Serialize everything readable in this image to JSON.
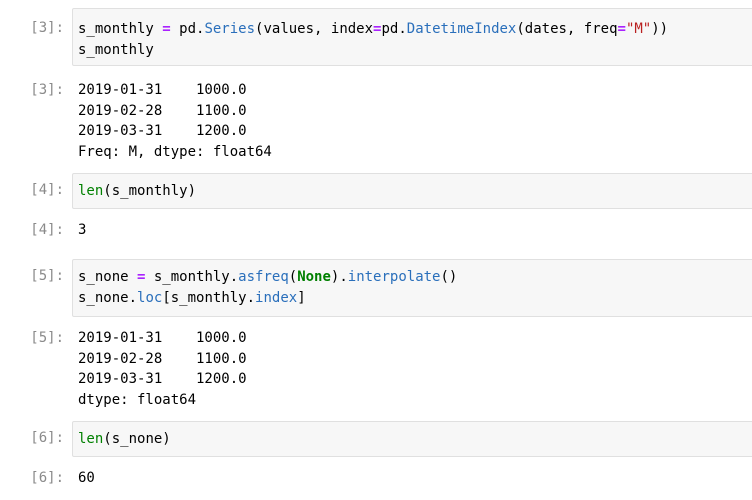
{
  "cells": [
    {
      "in_prompt": "[3]:",
      "code": [
        [
          [
            "s_monthly ",
            "t"
          ],
          [
            "=",
            "op"
          ],
          [
            " pd.",
            "t"
          ],
          [
            "Series",
            "fn"
          ],
          [
            "(values, index",
            "t"
          ],
          [
            "=",
            "op"
          ],
          [
            "pd.",
            "t"
          ],
          [
            "DatetimeIndex",
            "fn"
          ],
          [
            "(dates, freq",
            "t"
          ],
          [
            "=",
            "op"
          ],
          [
            "\"M\"",
            "str"
          ],
          [
            "))",
            "t"
          ]
        ],
        [
          [
            "s_monthly",
            "t"
          ]
        ]
      ],
      "out_prompt": "[3]:",
      "output": [
        "2019-01-31    1000.0",
        "2019-02-28    1100.0",
        "2019-03-31    1200.0",
        "Freq: M, dtype: float64"
      ]
    },
    {
      "in_prompt": "[4]:",
      "code": [
        [
          [
            "len",
            "builtin"
          ],
          [
            "(s_monthly)",
            "t"
          ]
        ]
      ],
      "out_prompt": "[4]:",
      "output": [
        "3"
      ]
    },
    {
      "in_prompt": "[5]:",
      "code": [
        [
          [
            "s_none ",
            "t"
          ],
          [
            "=",
            "op"
          ],
          [
            " s_monthly.",
            "t"
          ],
          [
            "asfreq",
            "fn"
          ],
          [
            "(",
            "t"
          ],
          [
            "None",
            "kw"
          ],
          [
            ").",
            "t"
          ],
          [
            "interpolate",
            "fn"
          ],
          [
            "()",
            "t"
          ]
        ],
        [
          [
            "s_none.",
            "t"
          ],
          [
            "loc",
            "fn"
          ],
          [
            "[s_monthly.",
            "t"
          ],
          [
            "index",
            "fn"
          ],
          [
            "]",
            "t"
          ]
        ]
      ],
      "out_prompt": "[5]:",
      "output": [
        "2019-01-31    1000.0",
        "2019-02-28    1100.0",
        "2019-03-31    1200.0",
        "dtype: float64"
      ]
    },
    {
      "in_prompt": "[6]:",
      "code": [
        [
          [
            "len",
            "builtin"
          ],
          [
            "(s_none)",
            "t"
          ]
        ]
      ],
      "out_prompt": "[6]:",
      "output": [
        "60"
      ]
    }
  ]
}
